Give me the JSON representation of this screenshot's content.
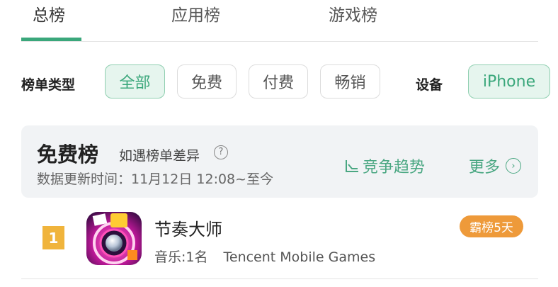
{
  "tabs": [
    {
      "label": "总榜",
      "active": true
    },
    {
      "label": "应用榜",
      "active": false
    },
    {
      "label": "游戏榜",
      "active": false
    }
  ],
  "filters": {
    "type_label": "榜单类型",
    "types": [
      {
        "label": "全部",
        "selected": true
      },
      {
        "label": "免费",
        "selected": false
      },
      {
        "label": "付费",
        "selected": false
      },
      {
        "label": "畅销",
        "selected": false
      }
    ],
    "device_label": "设备",
    "device": {
      "label": "iPhone",
      "selected": true
    }
  },
  "panel": {
    "title": "免费榜",
    "subtitle": "如遇榜单差异",
    "help_icon": "question-circle-icon",
    "update_text": "数据更新时间：11月12日 12:08~至今",
    "trend_label": "竞争趋势",
    "trend_icon": "trend-line-icon",
    "more_label": "更多",
    "more_icon": "chevron-right-circle-icon"
  },
  "apps": [
    {
      "rank": "1",
      "name": "节奏大师",
      "category": "音乐:1名",
      "developer": "Tencent Mobile Games",
      "tag": "霸榜5天",
      "icon": "rhythm-master-app-icon"
    }
  ],
  "colors": {
    "accent": "#3aa77b",
    "rank_badge": "#f0b43c",
    "tag": "#ee9a3a",
    "panel_bg": "#f1f3f5"
  }
}
